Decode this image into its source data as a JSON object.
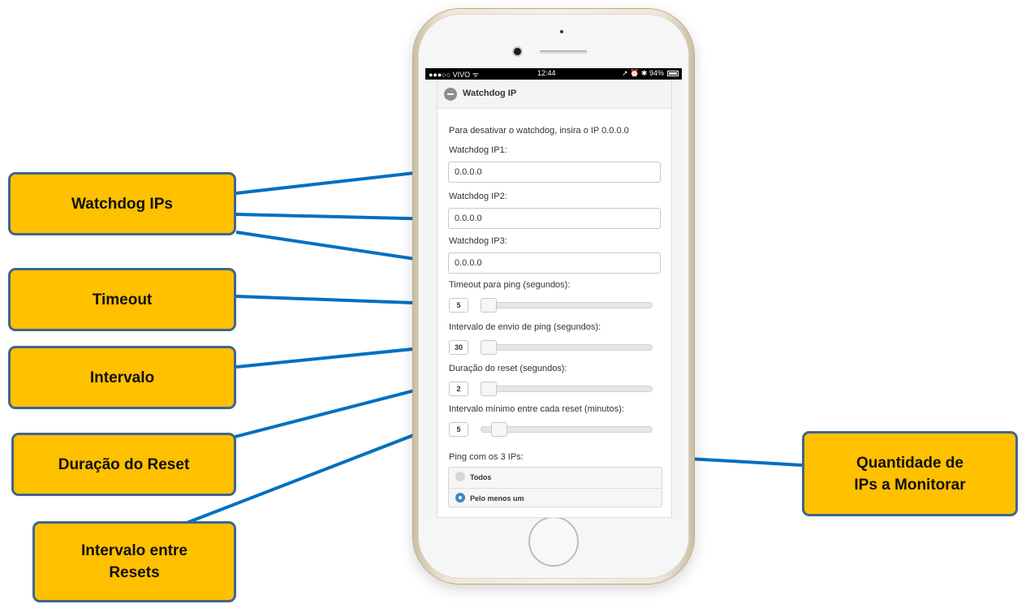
{
  "status_bar": {
    "carrier": "●●●○○ VIVO ᯤ",
    "time": "12:44",
    "right_icons": "➚ ⏰ ✱ 94%"
  },
  "panel": {
    "title": "Watchdog IP",
    "hint": "Para desativar o watchdog, insira o IP 0.0.0.0",
    "fields": [
      {
        "label": "Watchdog IP1:",
        "value": "0.0.0.0"
      },
      {
        "label": "Watchdog IP2:",
        "value": "0.0.0.0"
      },
      {
        "label": "Watchdog IP3:",
        "value": "0.0.0.0"
      }
    ],
    "sliders": [
      {
        "label": "Timeout para ping (segundos):",
        "value": "5"
      },
      {
        "label": "Intervalo de envio de ping (segundos):",
        "value": "30"
      },
      {
        "label": "Duração do reset (segundos):",
        "value": "2"
      },
      {
        "label": "Intervalo mínimo entre cada reset (minutos):",
        "value": "5"
      }
    ],
    "radio_label": "Ping com os 3 IPs:",
    "radio_options": [
      {
        "label": "Todos",
        "selected": false
      },
      {
        "label": "Pelo menos um",
        "selected": true
      }
    ]
  },
  "callouts": {
    "watchdog_ips": "Watchdog IPs",
    "timeout": "Timeout",
    "intervalo": "Intervalo",
    "duracao_reset": "Duração do Reset",
    "intervalo_resets_line1": "Intervalo entre",
    "intervalo_resets_line2": "Resets",
    "quantidade_line1": "Quantidade de",
    "quantidade_line2": "IPs a Monitorar"
  },
  "colors": {
    "callout_fill": "#ffc000",
    "callout_border": "#41658a",
    "arrow": "#0070c0",
    "radio_selected": "#3c87c9"
  }
}
